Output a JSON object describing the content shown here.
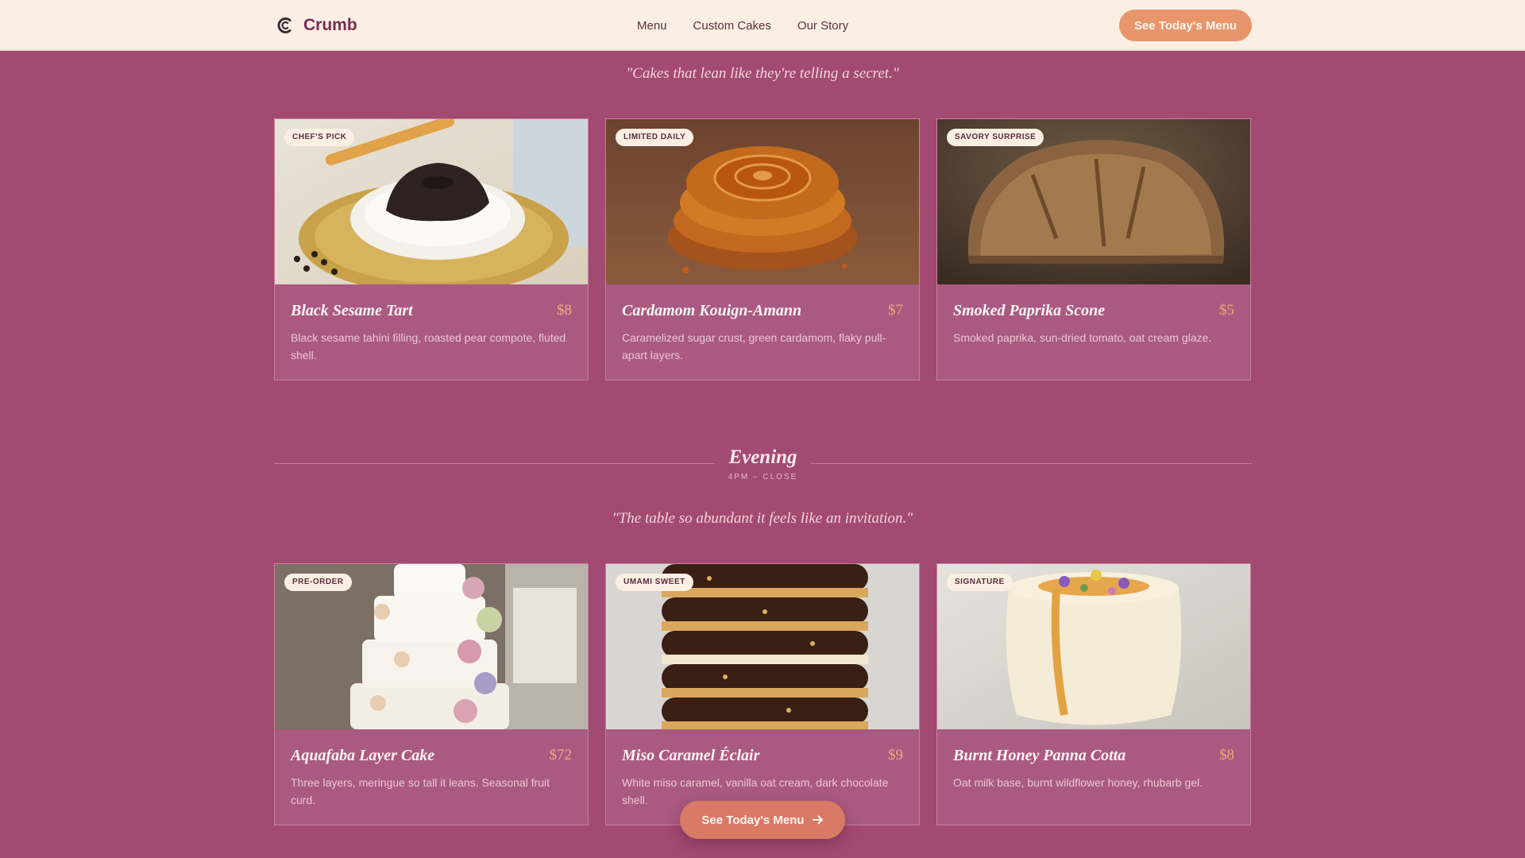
{
  "header": {
    "brand": "Crumb",
    "nav": [
      "Menu",
      "Custom Cakes",
      "Our Story"
    ],
    "cta_label": "See Today's Menu"
  },
  "morning": {
    "quote": "\"Cakes that lean like they're telling a secret.\"",
    "items": [
      {
        "badge": "CHEF'S PICK",
        "name": "Black Sesame Tart",
        "price": "$8",
        "description": "Black sesame tahini filling, roasted pear compote, fluted shell."
      },
      {
        "badge": "LIMITED DAILY",
        "name": "Cardamom Kouign-Amann",
        "price": "$7",
        "description": "Caramelized sugar crust, green cardamom, flaky pull-apart layers."
      },
      {
        "badge": "SAVORY SURPRISE",
        "name": "Smoked Paprika Scone",
        "price": "$5",
        "description": "Smoked paprika, sun-dried tomato, oat cream glaze."
      }
    ]
  },
  "evening": {
    "title": "Evening",
    "hours": "4PM – CLOSE",
    "quote": "\"The table so abundant it feels like an invitation.\"",
    "items": [
      {
        "badge": "PRE-ORDER",
        "name": "Aquafaba Layer Cake",
        "price": "$72",
        "description": "Three layers, meringue so tall it leans. Seasonal fruit curd."
      },
      {
        "badge": "UMAMI SWEET",
        "name": "Miso Caramel Éclair",
        "price": "$9",
        "description": "White miso caramel, vanilla oat cream, dark chocolate shell."
      },
      {
        "badge": "SIGNATURE",
        "name": "Burnt Honey Panna Cotta",
        "price": "$8",
        "description": "Oat milk base, burnt wildflower honey, rhubarb gel."
      }
    ]
  },
  "floating_cta": {
    "label": "See Today's Menu",
    "icon": "arrow-right-icon"
  },
  "colors": {
    "page_bg": "#a24a72",
    "header_bg": "#fbefe3",
    "accent": "#e8956c",
    "brand": "#7a2a55",
    "price": "#f2a877"
  }
}
